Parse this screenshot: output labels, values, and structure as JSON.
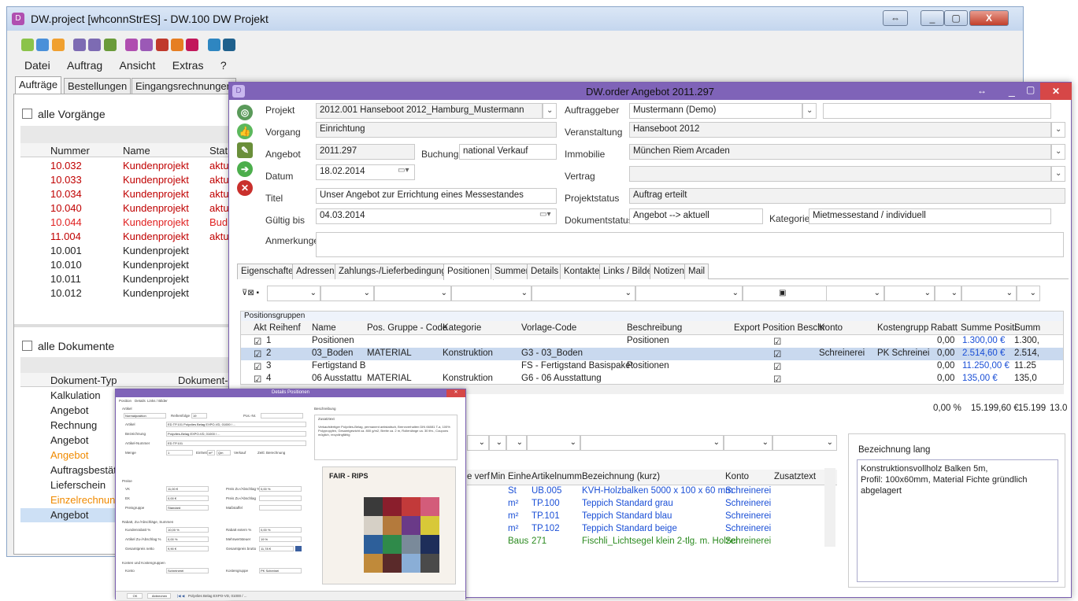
{
  "main": {
    "title": "DW.project [whconnStrES] - DW.100 DW Projekt",
    "menu": [
      "Datei",
      "Auftrag",
      "Ansicht",
      "Extras",
      "?"
    ],
    "tabs": [
      "Aufträge",
      "Bestellungen",
      "Eingangsrechnungen"
    ],
    "all_processes": "alle Vorgänge",
    "grid_headers": [
      "Nummer",
      "Name",
      "Stat"
    ],
    "orders": [
      {
        "nr": "10.032",
        "name": "Kundenprojekt",
        "status": "aktu",
        "color": "red"
      },
      {
        "nr": "10.033",
        "name": "Kundenprojekt",
        "status": "aktu",
        "color": "red"
      },
      {
        "nr": "10.034",
        "name": "Kundenprojekt",
        "status": "aktu",
        "color": "red"
      },
      {
        "nr": "10.040",
        "name": "Kundenprojekt",
        "status": "aktu",
        "color": "red"
      },
      {
        "nr": "10.044",
        "name": "Kundenprojekt",
        "status": "Bud",
        "color": "red2"
      },
      {
        "nr": "11.004",
        "name": "Kundenprojekt",
        "status": "aktu",
        "color": "red"
      },
      {
        "nr": "10.001",
        "name": "Kundenprojekt",
        "status": "",
        "color": "black"
      },
      {
        "nr": "10.010",
        "name": "Kundenprojekt",
        "status": "",
        "color": "black"
      },
      {
        "nr": "10.011",
        "name": "Kundenprojekt",
        "status": "",
        "color": "black"
      },
      {
        "nr": "10.012",
        "name": "Kundenprojekt",
        "status": "",
        "color": "black"
      }
    ],
    "all_documents": "alle Dokumente",
    "doc_headers": [
      "Dokument-Typ",
      "Dokument-N"
    ],
    "documents": [
      {
        "type": "Kalkulation",
        "color": "black"
      },
      {
        "type": "Angebot",
        "color": "black"
      },
      {
        "type": "Rechnung",
        "color": "black"
      },
      {
        "type": "Angebot",
        "color": "black"
      },
      {
        "type": "Angebot",
        "color": "orange"
      },
      {
        "type": "Auftragsbestät",
        "color": "black"
      },
      {
        "type": "Lieferschein",
        "color": "black"
      },
      {
        "type": "Einzelrechnung",
        "color": "orange"
      },
      {
        "type": "Angebot",
        "color": "black"
      }
    ]
  },
  "order": {
    "title": "DW.order Angebot 2011.297",
    "labels": {
      "projekt": "Projekt",
      "vorgang": "Vorgang",
      "angebot": "Angebot",
      "buchung": "Buchung",
      "datum": "Datum",
      "titel": "Titel",
      "gueltig": "Gültig bis",
      "anmerkungen": "Anmerkungen",
      "auftraggeber": "Auftraggeber",
      "veranstaltung": "Veranstaltung",
      "immobilie": "Immobilie",
      "vertrag": "Vertrag",
      "projektstatus": "Projektstatus",
      "dokumentstatus": "Dokumentstatus",
      "kategorie": "Kategorie"
    },
    "values": {
      "projekt": "2012.001 Hanseboot 2012_Hamburg_Mustermann",
      "vorgang": "Einrichtung",
      "angebot": "2011.297",
      "buchung": "national Verkauf",
      "datum": "18.02.2014",
      "titel": "Unser Angebot zur Errichtung eines Messestandes",
      "gueltig": "04.03.2014",
      "auftraggeber": "Mustermann (Demo)",
      "veranstaltung": "Hanseboot 2012",
      "immobilie": "München Riem Arcaden",
      "vertrag": "",
      "projektstatus": "Auftrag erteilt",
      "dokumentstatus": "Angebot --> aktuell",
      "kategorie": "Mietmessestand / individuell"
    },
    "tabs": [
      "Eigenschaften",
      "Adressen",
      "Zahlungs-/Lieferbedingungen",
      "Positionen",
      "Summen",
      "Details",
      "Kontakte",
      "Links / Bilder",
      "Notizen",
      "Mail"
    ],
    "group_caption": "Positionsgruppen",
    "group_headers": [
      "Akt",
      "Reihenf",
      "Name",
      "Pos. Gruppe - Code",
      "Kategorie",
      "Vorlage-Code",
      "Beschreibung",
      "Export Position Beschr",
      "Konto",
      "Kostengrupp",
      "Rabatt",
      "Summe Positi",
      "Summ"
    ],
    "groups": [
      {
        "akt": "1",
        "name": "Positionen",
        "code": "",
        "kat": "",
        "vorlage": "",
        "beschr": "Positionen",
        "konto": "",
        "kg": "",
        "rabatt": "0,00",
        "summe": "1.300,00 €",
        "summ": "1.300,"
      },
      {
        "akt": "2",
        "name": "03_Boden",
        "code": "MATERIAL",
        "kat": "Konstruktion",
        "vorlage": "G3 - 03_Boden",
        "beschr": "",
        "konto": "Schreinerei",
        "kg": "PK Schreinei",
        "rabatt": "0,00",
        "summe": "2.514,60 €",
        "summ": "2.514,"
      },
      {
        "akt": "3",
        "name": "Fertigstand B",
        "code": "",
        "kat": "",
        "vorlage": "FS - Fertigstand Basispaket",
        "beschr": "Positionen",
        "konto": "",
        "kg": "",
        "rabatt": "0,00",
        "summe": "11.250,00 €",
        "summ": "11.25"
      },
      {
        "akt": "4",
        "name": "06 Ausstattu",
        "code": "MATERIAL",
        "kat": "Konstruktion",
        "vorlage": "G6 - 06 Ausstattung",
        "beschr": "",
        "konto": "",
        "kg": "",
        "rabatt": "0,00",
        "summe": "135,00 €",
        "summ": "135,0"
      }
    ],
    "totals": {
      "rabatt": "0,00 %",
      "summe": "15.199,60 €",
      "summ": "15.199",
      "last": "13.0"
    },
    "pos_headers": [
      "e verf",
      "Min",
      "Einhe",
      "Artikelnumm",
      "Bezeichnung (kurz)",
      "Konto",
      "Zusatztext"
    ],
    "positions": [
      {
        "unit": "St",
        "art": "UB.005",
        "bez": "KVH-Holzbalken 5000 x 100 x 60 mm",
        "konto": "Schreinerei",
        "color": "blue"
      },
      {
        "unit": "m²",
        "art": "TP.100",
        "bez": "Teppich Standard grau",
        "konto": "Schreinerei",
        "color": "blue"
      },
      {
        "unit": "m²",
        "art": "TP.101",
        "bez": "Teppich Standard blau",
        "konto": "Schreinerei",
        "color": "blue"
      },
      {
        "unit": "m²",
        "art": "TP.102",
        "bez": "Teppich Standard beige",
        "konto": "Schreinerei",
        "color": "blue"
      },
      {
        "unit": "Baus",
        "art": "271",
        "bez": "Fischli_Lichtsegel klein 2-tlg. m. Holzei",
        "konto": "Schreinerei",
        "color": "green"
      }
    ],
    "long_caption": "Bezeichnung lang",
    "long_text": [
      "Konstruktionsvollholz Balken 5m,",
      "Profil: 100x60mm, Material Fichte gründlich",
      "abgelagert"
    ]
  },
  "detail": {
    "title": "Details Positionen",
    "tabs": [
      "Position",
      "Details",
      "Links / Bilder"
    ],
    "section_artikel": "Artikel",
    "normalposition": "Normalposition",
    "reihenfolge_label": "Reihenfolge",
    "reihenfolge": "19",
    "pos_nr_label": "Pos.-Nr.",
    "artikel_label": "Artikel",
    "artikel": "ED.TP.101 Polyvlies Belag EXPO-VD, 01000 / ...",
    "bezeichnung_label": "Bezeichnung",
    "bezeichnung": "Polyvlies-Belag EXPO-VD, 01000 / ...",
    "artikelnummer_label": "Artikel-Nummer",
    "artikelnummer": "ED.TP.101",
    "menge_label": "Menge",
    "menge": "1",
    "einheit_label": "Einheit",
    "einheit": "m²",
    "qm": "Qm",
    "verkauf": "Verkauf",
    "zeitl": "Zeitl. Berechnung",
    "section_preise": "Preise",
    "vk_label": "VK",
    "vk": "11,00 €",
    "ek_label": "EK",
    "ek": "0,00 €",
    "pzv_label": "Preis Zu-/Abschlag %",
    "pzv": "0,00 %",
    "pz_label": "Preis Zu-/Abschlag",
    "preisgruppe_label": "Preisgruppe",
    "preisgruppe": "Standard",
    "mst_label": "Maßstaffel",
    "section_rabatt": "Rabatt, Zu-/Abschläge, Summen",
    "rabatt_label": "Kundenrabatt %",
    "rabatt": "10,00 %",
    "rabatt_ext_label": "Rabatt extern %",
    "rabatt_ext": "0,00 %",
    "artzu_label": "Artikel Zu-/Abschlag %",
    "artzu": "0,00 %",
    "mwst_label": "Mehrwertsteuer",
    "mwst": "19 %",
    "netto_label": "Gesamtpreis netto",
    "netto": "9,90 €",
    "brutto_label": "Gesamtpreis brutto",
    "brutto": "11,78 €",
    "section_konten": "Konten und Kostengruppen",
    "konto_label": "Konto",
    "konto": "Schreinerei",
    "kg_label": "Kostengruppe",
    "kg": "PK Schreinei",
    "beschr_caption": "Beschreibung",
    "zusatztext": "Zusatztext",
    "desc": "Verkaufsfertiger Polyvlies-Belag, permanent antistatisch, Brennverhalten DIN 66081 T-a, 100% Polypropylen, Gesamtgewicht ca. 800 g/m2, Breite ca. 2 m, Rollenlänge ca. 30 lfm., Coupons möglich, recyclingfähig",
    "sample_title": "FAIR - RIPS",
    "ok": "OK",
    "abbrechen": "Abbrechen",
    "nav": "Polyvlies Belag EXPO-VD, 01000 / ..."
  },
  "colors": {
    "accent": "#7f63b8",
    "red": "#c00000",
    "orange": "#f08a00",
    "blue": "#1a4fd6",
    "green": "#2b8a1f"
  }
}
